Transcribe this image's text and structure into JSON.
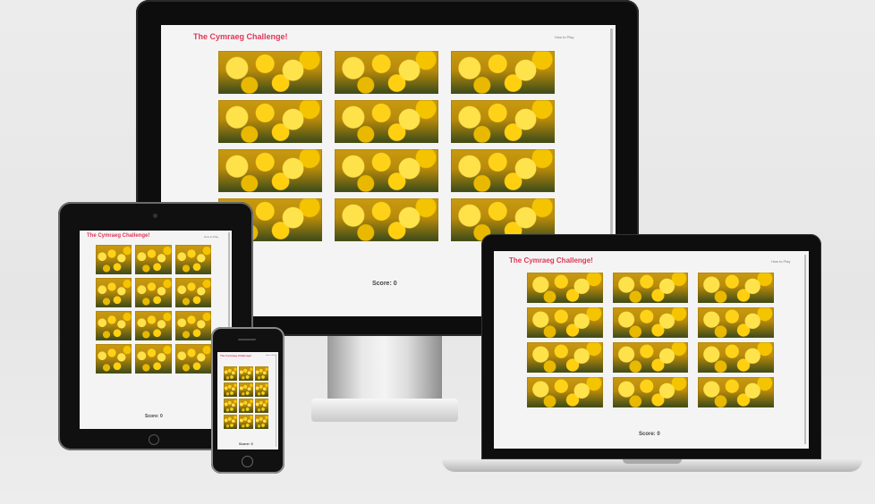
{
  "site": {
    "title": "The Cymraeg Challenge!",
    "nav_how_to_play": "How to Play",
    "score_text": "Score: 0"
  },
  "card_image": "daffodils-photo",
  "colors": {
    "title": "#e0365a",
    "page_bg": "#f4f4f4",
    "bezel": "#111111"
  }
}
